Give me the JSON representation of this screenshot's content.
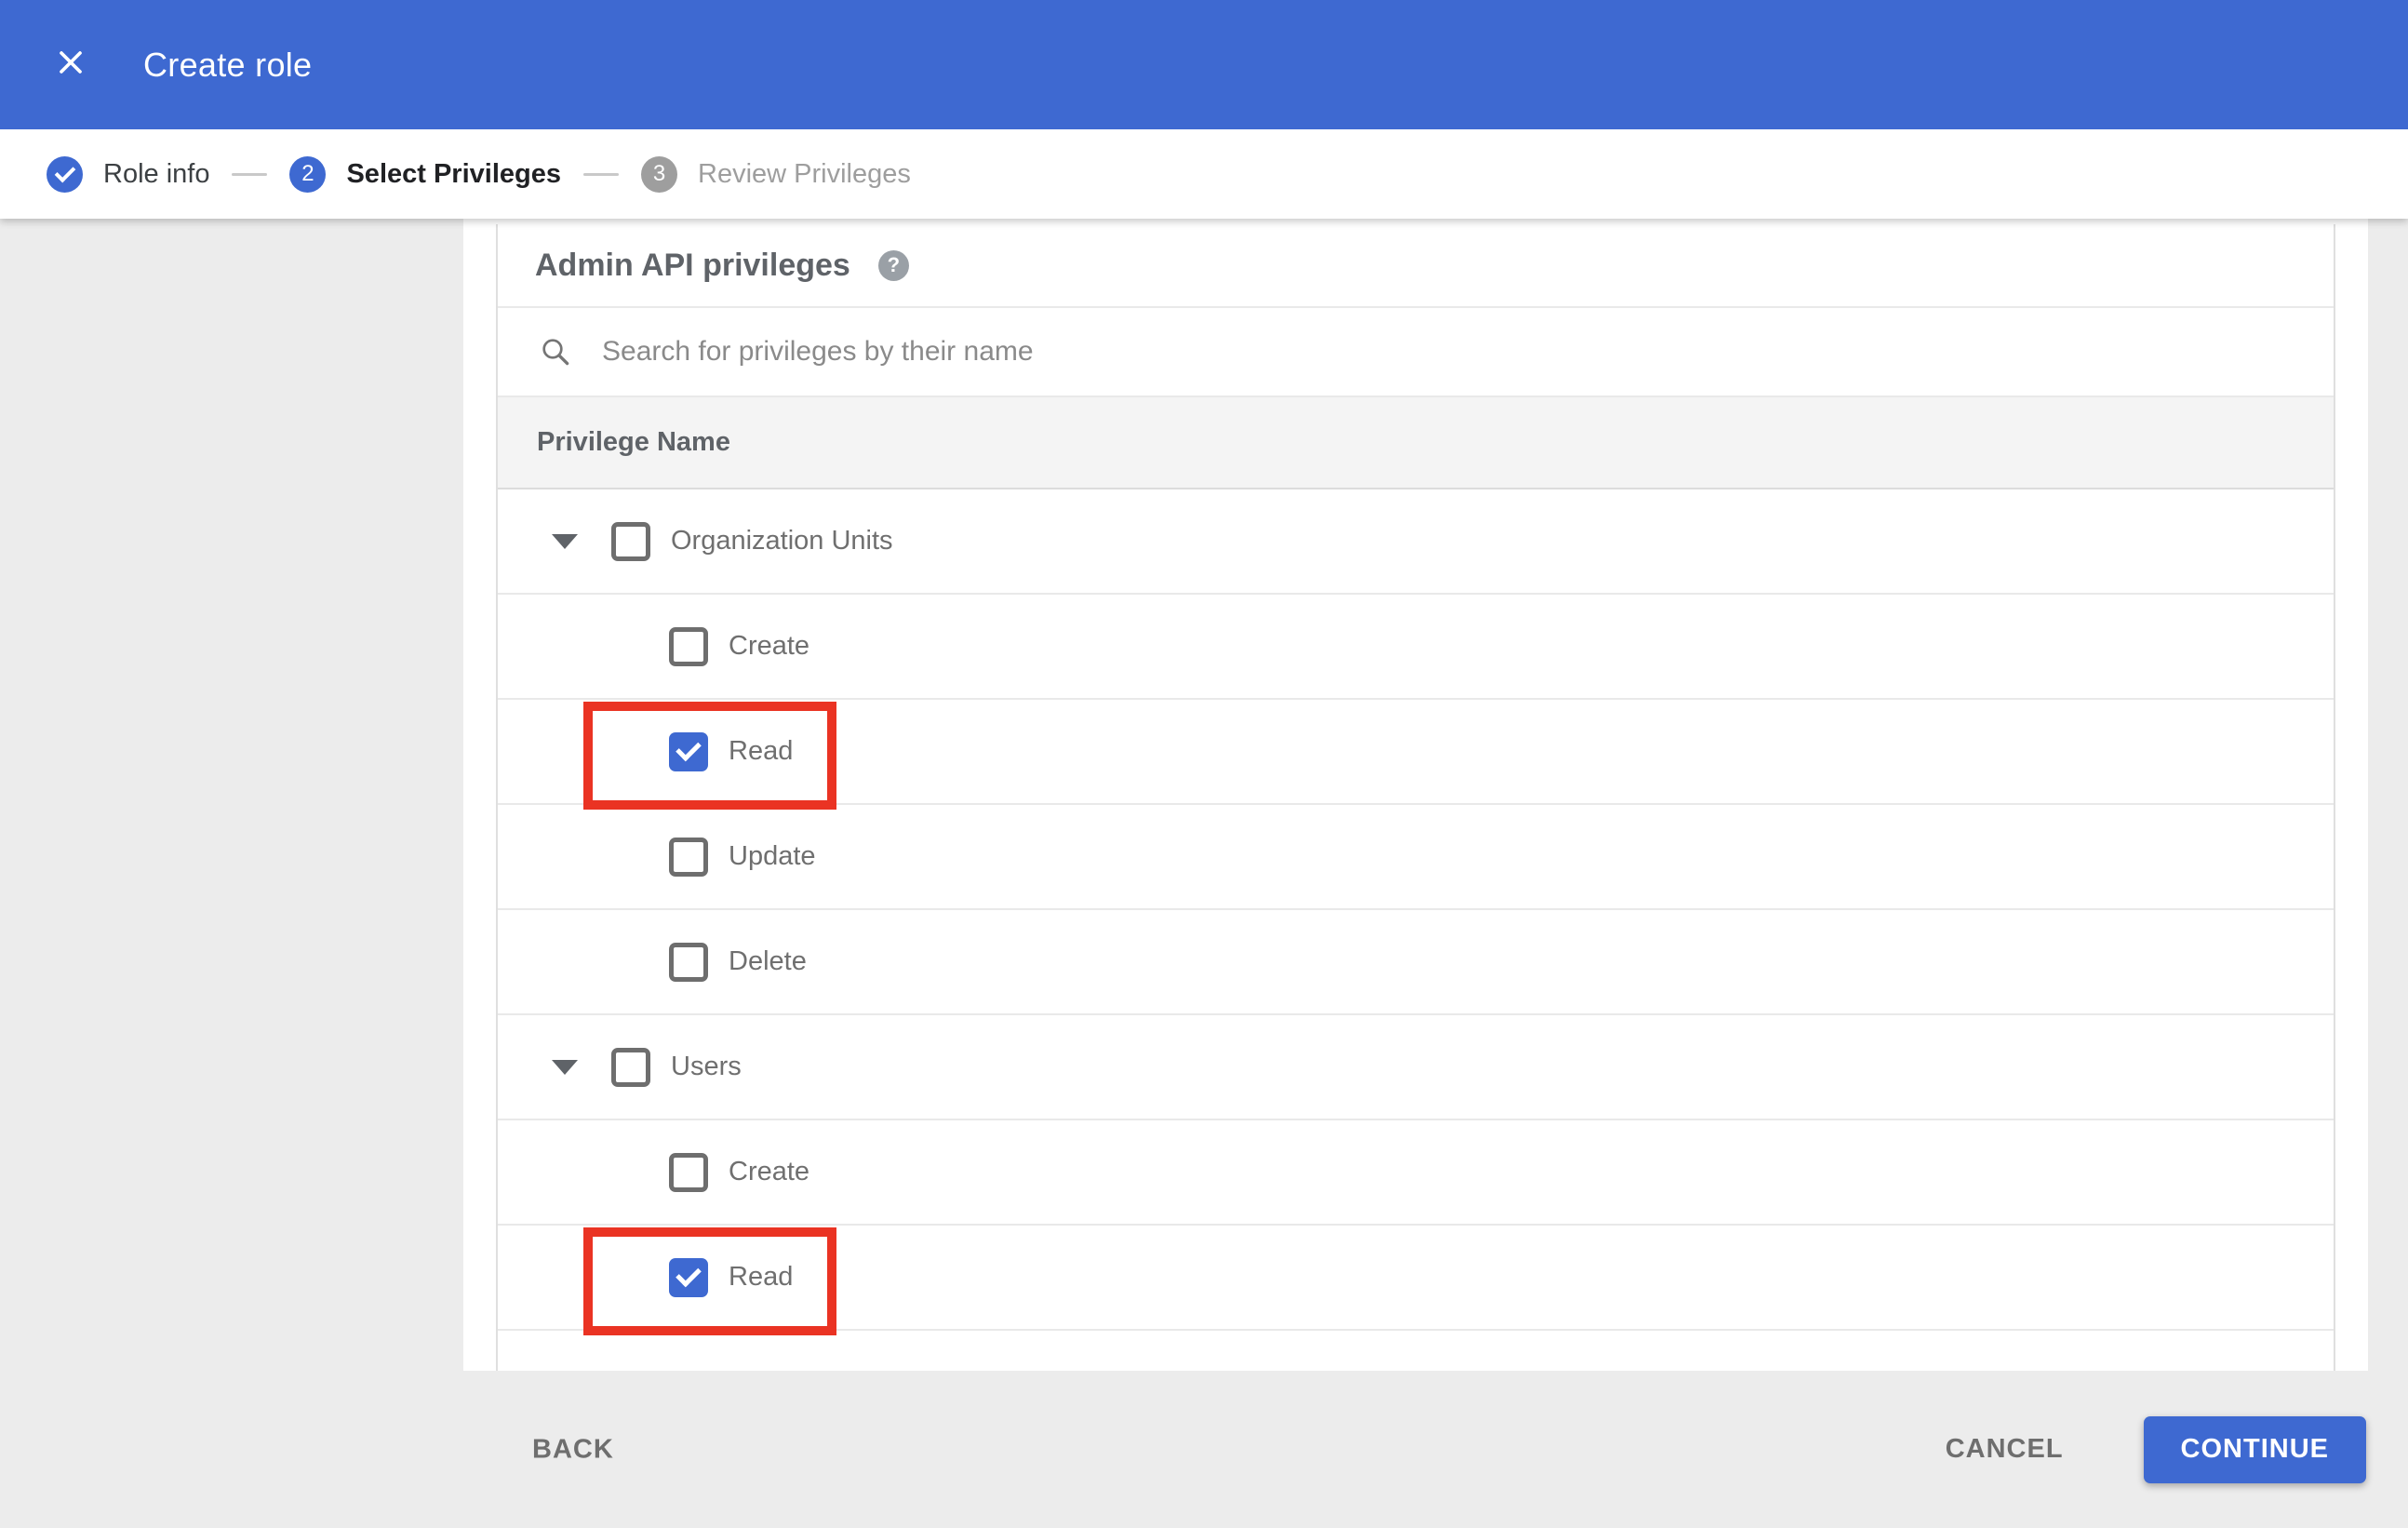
{
  "appbar": {
    "title": "Create role"
  },
  "stepper": {
    "steps": [
      {
        "label": "Role info",
        "state": "completed",
        "icon": "check"
      },
      {
        "label": "Select Privileges",
        "state": "active",
        "number": "2"
      },
      {
        "label": "Review Privileges",
        "state": "upcoming",
        "number": "3"
      }
    ]
  },
  "panel": {
    "title": "Admin API privileges",
    "help_icon": "question-mark",
    "search_placeholder": "Search for privileges by their name",
    "column_header": "Privilege Name"
  },
  "privileges": {
    "rows": [
      {
        "label": "Organization Units",
        "type": "group",
        "checked": false,
        "expanded": true,
        "highlighted": false
      },
      {
        "label": "Create",
        "type": "child",
        "checked": false,
        "highlighted": false
      },
      {
        "label": "Read",
        "type": "child",
        "checked": true,
        "highlighted": true
      },
      {
        "label": "Update",
        "type": "child",
        "checked": false,
        "highlighted": false
      },
      {
        "label": "Delete",
        "type": "child",
        "checked": false,
        "highlighted": false
      },
      {
        "label": "Users",
        "type": "group",
        "checked": false,
        "expanded": true,
        "highlighted": false
      },
      {
        "label": "Create",
        "type": "child",
        "checked": false,
        "highlighted": false
      },
      {
        "label": "Read",
        "type": "child",
        "checked": true,
        "highlighted": true
      }
    ]
  },
  "footer": {
    "back": "BACK",
    "cancel": "CANCEL",
    "continue": "CONTINUE"
  },
  "colors": {
    "accent_blue": "#3E69D1",
    "highlight_red": "#EA3323",
    "page_gray": "#ECECEC",
    "header_band_gray": "#F4F4F4",
    "step_upcoming_gray": "#9E9E9E"
  }
}
